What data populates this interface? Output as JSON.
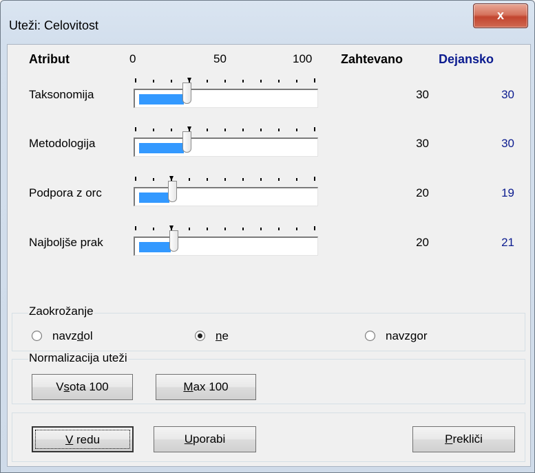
{
  "window": {
    "title": "Uteži: Celovitost",
    "close_glyph": "x"
  },
  "header": {
    "attribute": "Atribut",
    "scale": [
      "0",
      "50",
      "100"
    ],
    "required": "Zahtevano",
    "actual": "Dejansko"
  },
  "rows": [
    {
      "label": "Taksonomija",
      "required": "30",
      "actual": "30",
      "slider_value": 30,
      "marker_value": 30
    },
    {
      "label": "Metodologija",
      "required": "30",
      "actual": "30",
      "slider_value": 30,
      "marker_value": 30
    },
    {
      "label": "Podpora z orc",
      "required": "20",
      "actual": "19",
      "slider_value": 20,
      "marker_value": 20
    },
    {
      "label": "Najboljše prak",
      "required": "20",
      "actual": "21",
      "slider_value": 21,
      "marker_value": 20
    }
  ],
  "rounding": {
    "title": "Zaokrožanje",
    "options": [
      {
        "pre": "navz",
        "key": "d",
        "post": "ol",
        "checked": false
      },
      {
        "pre": "",
        "key": "n",
        "post": "e",
        "checked": true
      },
      {
        "pre": "navz",
        "key": "g",
        "post": "or",
        "checked": false
      }
    ]
  },
  "normalization": {
    "title": "Normalizacija uteži",
    "sum_button": {
      "pre": "V",
      "key": "s",
      "post": "ota 100"
    },
    "max_button": {
      "pre": "",
      "key": "M",
      "post": "ax 100"
    }
  },
  "footer": {
    "ok": {
      "key": "V",
      "post": " redu"
    },
    "apply": {
      "key": "U",
      "post": "porabi"
    },
    "cancel": {
      "key": "P",
      "post": "rekliči"
    }
  },
  "colors": {
    "slider_fill": "#3399ff",
    "actual_text": "#0b1b8f"
  }
}
